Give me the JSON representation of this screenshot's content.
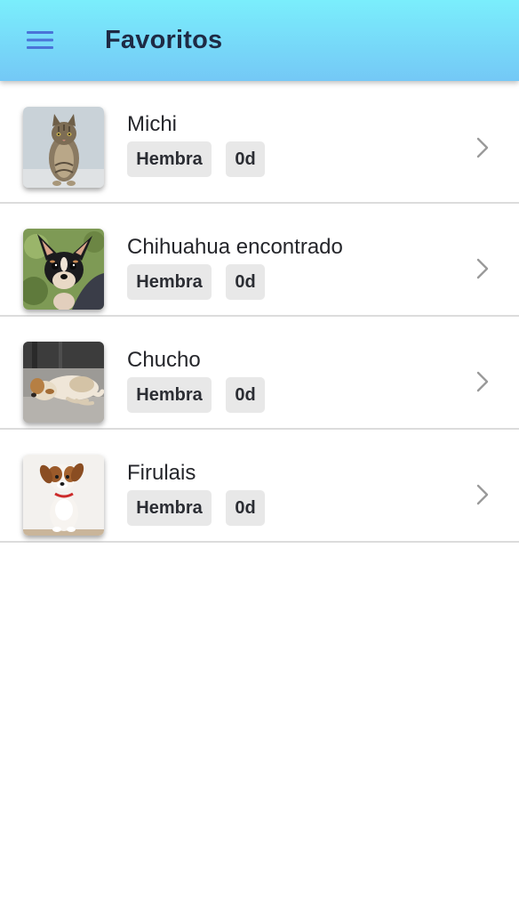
{
  "header": {
    "title": "Favoritos",
    "menu_icon": "hamburger-menu-icon",
    "colors": {
      "gradient_top": "#7aeefc",
      "gradient_bottom": "#74c8f6",
      "menu_icon": "#4a74d8"
    }
  },
  "favorites": [
    {
      "name": "Michi",
      "sex": "Hembra",
      "age": "0d",
      "photo": "cat-photo"
    },
    {
      "name": "Chihuahua encontrado",
      "sex": "Hembra",
      "age": "0d",
      "photo": "chihuahua-photo"
    },
    {
      "name": "Chucho",
      "sex": "Hembra",
      "age": "0d",
      "photo": "sleeping-dog-photo"
    },
    {
      "name": "Firulais",
      "sex": "Hembra",
      "age": "0d",
      "photo": "puppy-photo"
    }
  ]
}
